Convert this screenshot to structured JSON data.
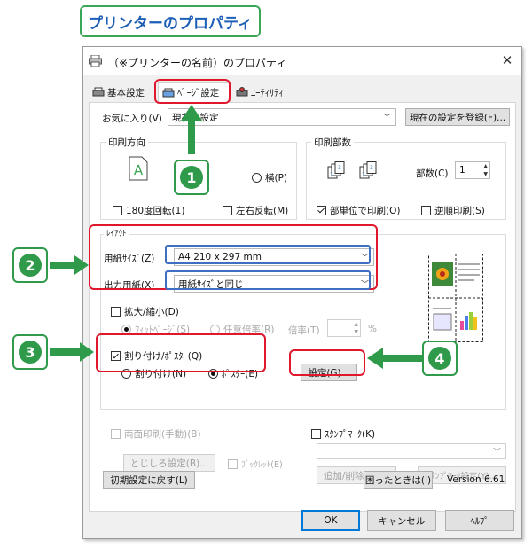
{
  "banner": {
    "title": "プリンターのプロパティ"
  },
  "window": {
    "title": "（※プリンターの名前）のプロパティ",
    "close": "✕"
  },
  "tabs": [
    {
      "label": "基本設定"
    },
    {
      "label": "ﾍﾟｰｼﾞ設定"
    },
    {
      "label": "ﾕｰﾃｨﾘﾃｨ"
    }
  ],
  "favorites": {
    "label": "お気に入り(V)",
    "value": "現在の設定",
    "register_button": "現在の設定を登録(F)..."
  },
  "orientation": {
    "group": "印刷方向",
    "landscape": "横(P)",
    "rotate180": "180度回転(1)",
    "mirror": "左右反転(M)"
  },
  "copies": {
    "group": "印刷部数",
    "count_label": "部数(C)",
    "count": "1",
    "collate": "部単位で印刷(O)",
    "reverse": "逆順印刷(S)"
  },
  "layout": {
    "group": "ﾚｲｱｳﾄ",
    "paper_size_label": "用紙ｻｲｽﾞ(Z)",
    "paper_size_value": "A4 210 x 297 mm",
    "output_paper_label": "出力用紙(X)",
    "output_paper_value": "用紙ｻｲｽﾞと同じ"
  },
  "scaling": {
    "label": "拡大/縮小(D)",
    "fit_page": "ﾌｨｯﾄﾍﾟｰｼﾞ(S)",
    "custom": "任意倍率(R)",
    "ratio_label": "倍率(T)",
    "unit": "%"
  },
  "nup": {
    "label": "割り付け/ﾎﾟｽﾀｰ(Q)",
    "nup_option": "割り付け(N)",
    "poster_option": "ﾎﾟｽﾀｰ(E)",
    "settings_button": "設定(G)..."
  },
  "duplex": {
    "label": "両面印刷(手動)(B)",
    "binding_button": "とじしろ設定(B)...",
    "booklet": "ﾌﾞｯｸﾚｯﾄ(E)"
  },
  "stamp": {
    "label": "ｽﾀﾝﾌﾟﾏｰｸ(K)",
    "add_remove": "追加/削除(W)...",
    "settings": "ｽﾀﾝﾌﾟﾏｰｸ設定(Y)..."
  },
  "footer": {
    "defaults": "初期設定に戻す(L)",
    "help": "困ったときは(I)",
    "version": "Version 6.61"
  },
  "buttons": {
    "ok": "OK",
    "cancel": "キャンセル",
    "apply": "ﾍﾙﾌﾟ"
  },
  "callouts": [
    "1",
    "2",
    "3",
    "4"
  ],
  "colors": {
    "highlight_red": "#e0182d",
    "callout_green": "#2e9a4a",
    "banner_blue": "#1e5fb8"
  }
}
